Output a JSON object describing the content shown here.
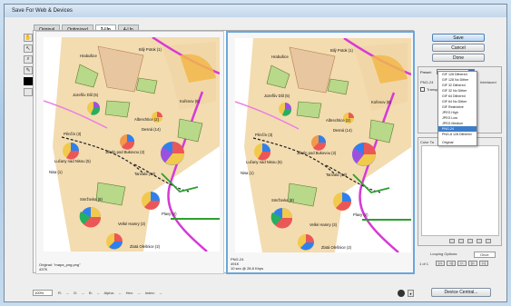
{
  "window": {
    "title": "Save For Web & Devices"
  },
  "tabs": [
    "Original",
    "Optimized",
    "2-Up",
    "4-Up"
  ],
  "active_tab": "2-Up",
  "tools": [
    {
      "name": "hand-tool-icon",
      "glyph": "✋"
    },
    {
      "name": "slice-select-tool-icon",
      "glyph": "↖"
    },
    {
      "name": "zoom-tool-icon",
      "glyph": "⌕"
    },
    {
      "name": "eyedropper-tool-icon",
      "glyph": "✎"
    }
  ],
  "panes": {
    "left": {
      "line1": "Original: \"mapa_png.png\"",
      "line2": "437K"
    },
    "right": {
      "line1": "PNG-24",
      "line2": "491K",
      "line3": "10 sec @ 28.8 Kbps"
    }
  },
  "map_labels": [
    "Hrabušice",
    "Bilý Potok (1)",
    "Jozefův Důl (5)",
    "Kořenov (8)",
    "Albrechtice (2)",
    "Desná (14)",
    "Lučany nad Nisou (5)",
    "Jiřetín pod Bukovou (2)",
    "Tanvald (13)",
    "Plavy (2)",
    "Smržovka (8)",
    "Velké Hamry (3)",
    "Pěnčín (3)",
    "Zlatá Olešnice (2)",
    "Nisa (1)"
  ],
  "buttons": {
    "save": "Save",
    "cancel": "Cancel",
    "done": "Done"
  },
  "preset": {
    "label": "Preset:",
    "value": "PNG-24",
    "format_label": "PNG-24",
    "transparency_label": "Transp",
    "interlaced_label": "Interlaced"
  },
  "preset_options": [
    "GIF 128 Dithered",
    "GIF 128 No Dither",
    "GIF 32 Dithered",
    "GIF 32 No Dither",
    "GIF 64 Dithered",
    "GIF 64 No Dither",
    "GIF Restrictive",
    "JPEG High",
    "JPEG Low",
    "JPEG Medium",
    "PNG-24",
    "PNG-8 128 Dithered",
    "Original"
  ],
  "selected_preset": "PNG-24",
  "color_table": {
    "label": "Color Ta"
  },
  "looping": {
    "label": "Looping Options:",
    "value": "Once",
    "frame": "1 of 1"
  },
  "status": {
    "zoom": "100%",
    "readout": "R: -- G: -- B: -- Alpha: -- Hex: -- Index: --"
  },
  "device_central_label": "Device Central...",
  "colors": {
    "selected_pane_border": "#6aa7da",
    "highlight": "#3d7cc9",
    "map_beige": "#f3dcb0",
    "map_green": "#b8d88a",
    "border_magenta": "#d63ad6"
  }
}
